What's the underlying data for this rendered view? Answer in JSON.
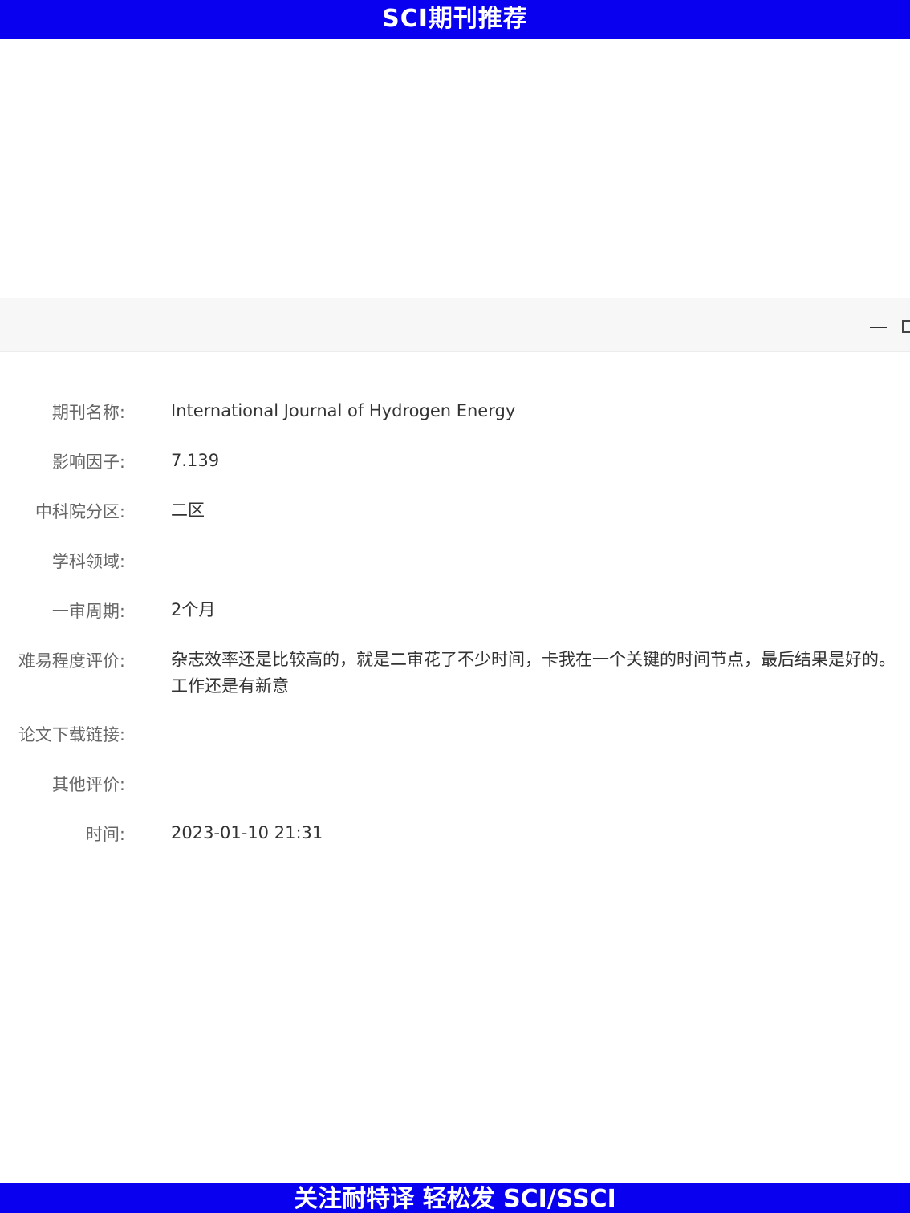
{
  "banner": {
    "top_text": "SCI期刊推荐",
    "bottom_text": "关注耐特译 轻松发 SCI/SSCI",
    "color": "#0a00f0"
  },
  "window": {
    "controls": [
      "minimize-icon",
      "restore-icon"
    ]
  },
  "fields": [
    {
      "label": "期刊名称:",
      "value": "International Journal of Hydrogen Energy"
    },
    {
      "label": "影响因子:",
      "value": "7.139"
    },
    {
      "label": "中科院分区:",
      "value": "二区"
    },
    {
      "label": "学科领域:",
      "value": ""
    },
    {
      "label": "一审周期:",
      "value": "2个月"
    },
    {
      "label": "难易程度评价:",
      "value": "杂志效率还是比较高的，就是二审花了不少时间，卡我在一个关键的时间节点，最后结果是好的。工作还是有新意"
    },
    {
      "label": "论文下载链接:",
      "value": ""
    },
    {
      "label": "其他评价:",
      "value": ""
    },
    {
      "label": "时间:",
      "value": "2023-01-10 21:31"
    }
  ]
}
